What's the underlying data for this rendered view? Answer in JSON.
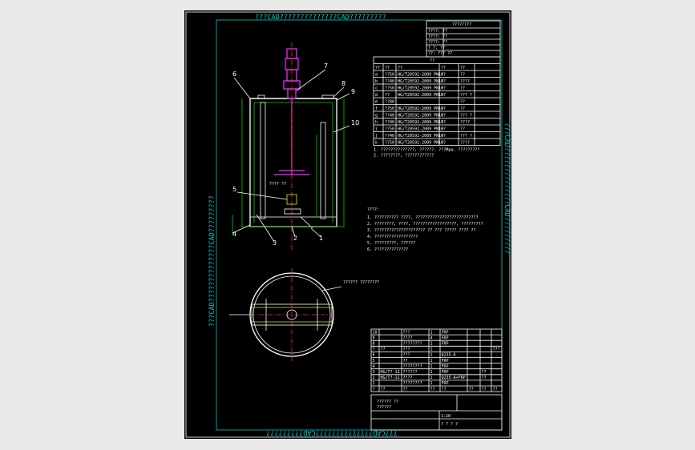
{
  "watermark": {
    "top": "???CAD??????????????CAD?????????",
    "left": "???CAD??????????????CAD?????????",
    "right": "???CAD??????????????CAD?????????",
    "bottom": "???CAD??????????????CAD?????????"
  },
  "cursor_mark": "[",
  "callouts": [
    "1",
    "2",
    "3",
    "4",
    "5",
    "6",
    "7",
    "8",
    "9",
    "10"
  ],
  "tank_note": "????\n??",
  "plan_note": "??????\n????????",
  "spec_table": {
    "title": "????????",
    "rows": [
      "????: ??",
      "????: ??",
      "????: ??",
      "?  ?: ??",
      "??: ??? ??"
    ]
  },
  "nozzle_table": {
    "title": "??",
    "headers": [
      "??",
      "??",
      "??",
      "??",
      "??"
    ],
    "rows": [
      [
        "a",
        "??50",
        "HG/T20592-2009 PN10",
        "??",
        "??"
      ],
      [
        "b",
        "??40",
        "HG/T20592-2009 PN10",
        "??",
        "????"
      ],
      [
        "c",
        "??50",
        "HG/T20592-2009 PN10",
        "??",
        "??"
      ],
      [
        "d",
        "??",
        "HG/T20592-2009 PN10",
        "??",
        "??? ?"
      ],
      [
        "e",
        "??80",
        "",
        "",
        "??"
      ],
      [
        "f",
        "??50",
        "HG/T20592-2009 PN10",
        "??",
        "??"
      ],
      [
        "g",
        "??40",
        "HG/T20592-2009 PN10",
        "??",
        "??? ?"
      ],
      [
        "h",
        "??40",
        "HG/T20592-2009 PN10",
        "??",
        "????"
      ],
      [
        "i",
        "??50",
        "HG/T20592-2009 PN10",
        "??",
        "??"
      ],
      [
        "j",
        "??40",
        "HG/T20592-2009 PN10",
        "??",
        "??? ?"
      ],
      [
        "k",
        "??50",
        "HG/T20592-2009 PN10",
        "??",
        "????"
      ]
    ],
    "footnote": "1. ??????????????, ??????, ???Mpa, ?????????\n2. ????????, ????????????"
  },
  "tech_notes": {
    "title": "????:",
    "items": [
      "1. ?????????? ????, ??????????????????????????",
      "2. ????????, ????, ??????????????????, ?????????",
      "3. ????????????????????? ?? ??? ????? ???? ??",
      "4. ??????????????????",
      "5. ?????????, ??????",
      "6. ??????????????"
    ]
  },
  "bom": {
    "rows": [
      [
        "10",
        "",
        "???",
        "1",
        "FRP",
        "",
        "",
        ""
      ],
      [
        "9",
        "",
        "????",
        "4",
        "FRP",
        "",
        "",
        ""
      ],
      [
        "8",
        "",
        "????????",
        "1",
        "FRP",
        "",
        "",
        ""
      ],
      [
        "7",
        "??",
        "???",
        "1",
        "",
        "",
        "",
        "???"
      ],
      [
        "6",
        "",
        "???",
        "1",
        "Q235-A",
        "",
        "",
        ""
      ],
      [
        "5",
        "",
        "??",
        "1",
        "FRP",
        "",
        "",
        ""
      ],
      [
        "4",
        "",
        "????????",
        "1",
        "FRP",
        "",
        "",
        ""
      ],
      [
        "3",
        "HG/T?-12",
        "??????",
        "1",
        "FRP",
        "",
        "??",
        ""
      ],
      [
        "2",
        "HG/T?-11",
        "????",
        "1",
        "Q235-A+FRP",
        "",
        "??",
        ""
      ],
      [
        "1",
        "",
        "????????",
        "1",
        "FRP",
        "",
        "",
        ""
      ]
    ],
    "header": [
      "?",
      "??",
      "??",
      "??",
      "??",
      "??",
      "??",
      "??"
    ]
  },
  "title_block": {
    "product": "?????? ??",
    "drawing_name": "??????",
    "scale": "1:20",
    "sheet": "? ? ? ?"
  }
}
